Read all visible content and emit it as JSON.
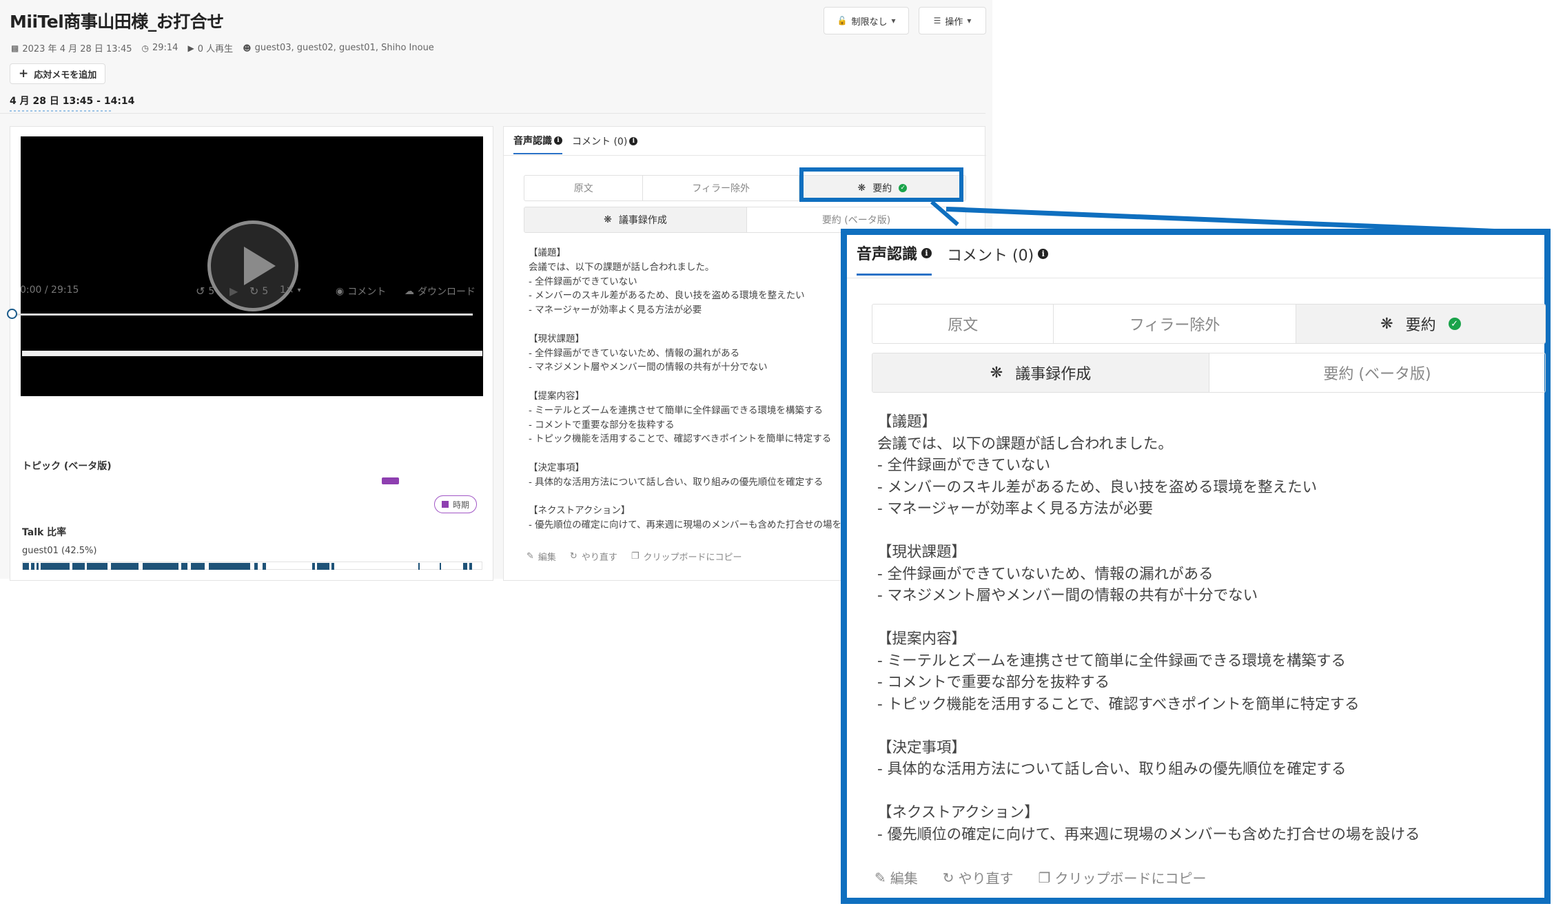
{
  "header": {
    "title": "MiiTel商事山田様_お打合せ",
    "meta": {
      "date": "2023 年 4 月 28 日 13:45",
      "duration": "29:14",
      "plays": "0 人再生",
      "participants": "guest03, guest02, guest01, Shiho Inoue"
    },
    "restrict_label": "制限なし",
    "ops_label": "操作",
    "add_memo_label": "応対メモを追加",
    "range_label": "4 月 28 日 13:45 - 14:14"
  },
  "player": {
    "time": "0:00 / 29:15",
    "rewind": "5",
    "forward": "5",
    "speed": "1×",
    "comment_label": "コメント",
    "download_label": "ダウンロード",
    "progress": 0
  },
  "topics": {
    "heading": "トピック (ベータ版)",
    "badge": "時期",
    "color": "#8e3fb0"
  },
  "talk": {
    "heading": "Talk 比率",
    "speaker_label": "guest01 (42.5%)",
    "color": "#1f5378"
  },
  "summary": {
    "tabs": {
      "speech": "音声認識",
      "comment": "コメント (0)"
    },
    "views": [
      "原文",
      "フィラー除外",
      "要約"
    ],
    "modes": [
      "議事録作成",
      "要約 (ベータ版)"
    ],
    "sections": [
      {
        "heading": "【議題】",
        "lines": [
          "会議では、以下の課題が話し合われました。",
          "- 全件録画ができていない",
          "- メンバーのスキル差があるため、良い技を盗める環境を整えたい",
          "- マネージャーが効率よく見る方法が必要"
        ]
      },
      {
        "heading": "【現状課題】",
        "lines": [
          "- 全件録画ができていないため、情報の漏れがある",
          "- マネジメント層やメンバー間の情報の共有が十分でない"
        ]
      },
      {
        "heading": "【提案内容】",
        "lines": [
          "- ミーテルとズームを連携させて簡単に全件録画できる環境を構築する",
          "- コメントで重要な部分を抜粋する",
          "- トピック機能を活用することで、確認すべきポイントを簡単に特定する"
        ]
      },
      {
        "heading": "【決定事項】",
        "lines": [
          "- 具体的な活用方法について話し合い、取り組みの優先順位を確定する"
        ]
      },
      {
        "heading": "【ネクストアクション】",
        "lines": [
          "- 優先順位の確定に向けて、再来週に現場のメンバーも含めた打合せの場を設ける"
        ]
      }
    ],
    "actions": {
      "edit": "編集",
      "redo": "やり直す",
      "copy": "クリップボードにコピー"
    }
  },
  "colors": {
    "accent": "#0f6fbf",
    "tab_underline": "#2a72c7",
    "success": "#1aa34a"
  }
}
